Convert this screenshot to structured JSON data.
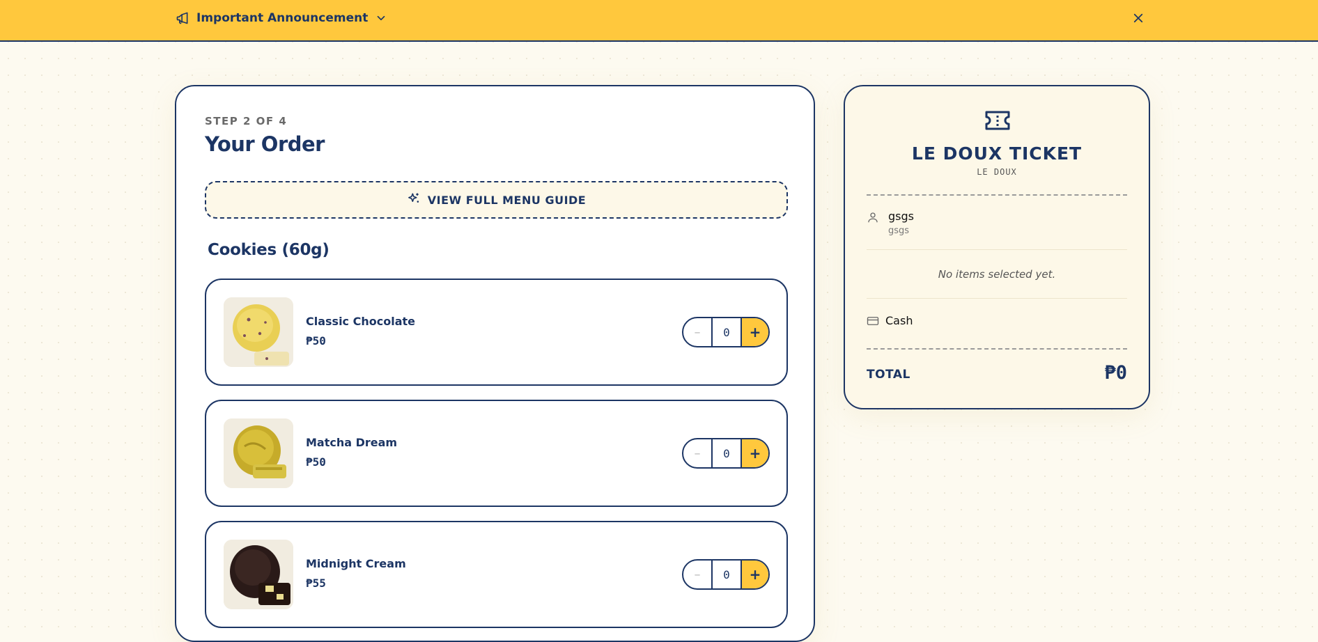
{
  "banner": {
    "label": "Important Announcement",
    "icon": "megaphone-icon",
    "toggle_icon": "chevron-down-icon",
    "close_icon": "close-icon",
    "background": "#ffc83d"
  },
  "order": {
    "step": "STEP 2 OF 4",
    "title": "Your Order",
    "menu_guide_label": "VIEW FULL MENU GUIDE",
    "section_title": "Cookies (60g)",
    "items": [
      {
        "name": "Classic Chocolate",
        "price": "₱50",
        "quantity": "0",
        "minus": "–",
        "plus": "+"
      },
      {
        "name": "Matcha Dream",
        "price": "₱50",
        "quantity": "0",
        "minus": "–",
        "plus": "+"
      },
      {
        "name": "Midnight Cream",
        "price": "₱55",
        "quantity": "0",
        "minus": "–",
        "plus": "+"
      }
    ]
  },
  "ticket": {
    "title": "LE DOUX TICKET",
    "subtitle": "LE DOUX",
    "customer_name": "gsgs",
    "customer_detail": "gsgs",
    "empty_message": "No items selected yet.",
    "payment_method": "Cash",
    "total_label": "TOTAL",
    "total_value": "₱0"
  },
  "colors": {
    "accent": "#ffc83d",
    "navy": "#1c3564",
    "cream": "#fdf8e8"
  }
}
